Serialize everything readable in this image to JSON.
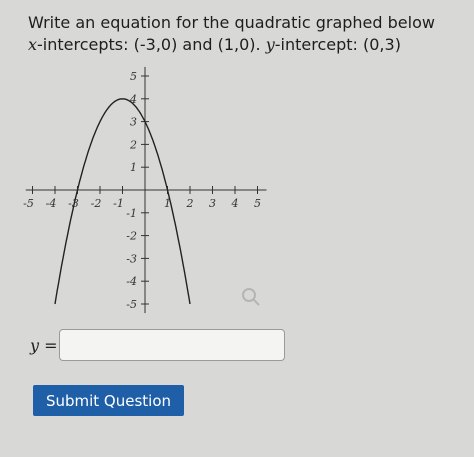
{
  "question": {
    "line1": "Write an equation for the quadratic graphed below",
    "x_var": "x",
    "x_intercepts_text": "-intercepts: (-3,0) and (1,0).",
    "y_var": "y",
    "y_intercept_text": "-intercept: (0,3)"
  },
  "graph": {
    "x_ticks": [
      "-5",
      "-4",
      "-3",
      "-2",
      "-1",
      "1",
      "2",
      "3",
      "4",
      "5"
    ],
    "y_ticks_positive": [
      "1",
      "2",
      "3",
      "4",
      "5"
    ],
    "y_ticks_negative": [
      "-1",
      "-2",
      "-3",
      "-4",
      "-5"
    ],
    "xlim": [
      -5,
      5
    ],
    "ylim": [
      -5,
      5
    ],
    "curve_color": "#222222",
    "zoom_icon": "magnifier-icon"
  },
  "answer": {
    "label_var": "y",
    "label_suffix": " =",
    "value": "",
    "placeholder": ""
  },
  "submit": {
    "label": "Submit Question",
    "color": "#1f5fa8"
  }
}
